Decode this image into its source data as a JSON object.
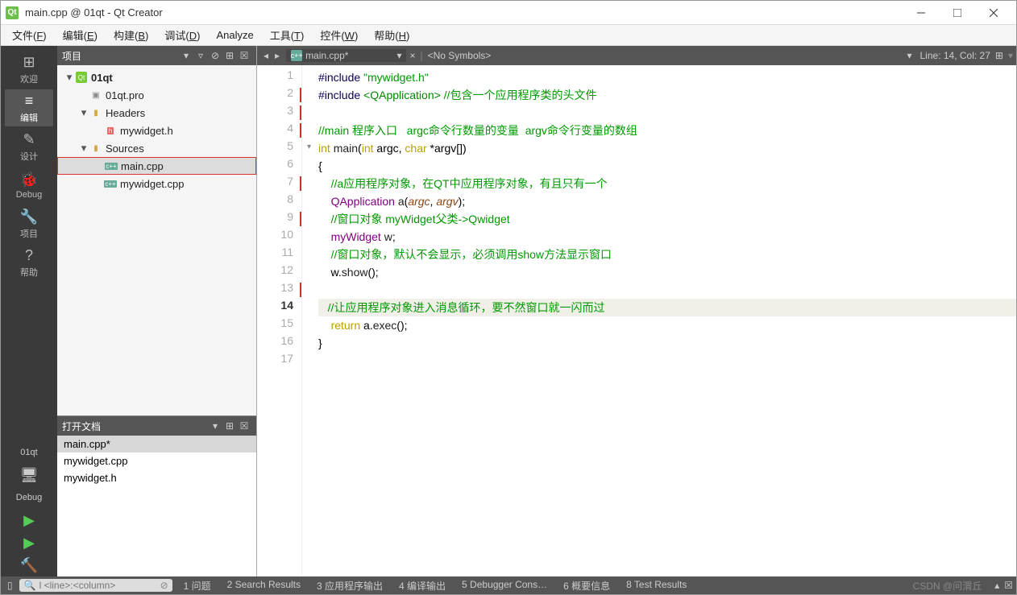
{
  "title": "main.cpp @ 01qt - Qt Creator",
  "menus": [
    "文件(F)",
    "编辑(E)",
    "构建(B)",
    "调试(D)",
    "Analyze",
    "工具(T)",
    "控件(W)",
    "帮助(H)"
  ],
  "modes": [
    {
      "icon": "⊞",
      "label": "欢迎"
    },
    {
      "icon": "≡",
      "label": "编辑",
      "active": true
    },
    {
      "icon": "✎",
      "label": "设计"
    },
    {
      "icon": "🐞",
      "label": "Debug"
    },
    {
      "icon": "🔧",
      "label": "项目"
    },
    {
      "icon": "?",
      "label": "帮助"
    }
  ],
  "run_targets": [
    {
      "label": "01qt"
    },
    {
      "label": "🖥"
    },
    {
      "label": "Debug"
    },
    {
      "label": "▶",
      "color": "#5c5"
    },
    {
      "label": "▶",
      "color": "#5c5",
      "bug": true
    },
    {
      "label": "🔨",
      "color": "#d97"
    }
  ],
  "projectPane": {
    "title": "项目",
    "tree": [
      {
        "indent": 0,
        "chev": "▾",
        "icon": "qt",
        "name": "01qt",
        "bold": true
      },
      {
        "indent": 1,
        "chev": "",
        "icon": "pro",
        "name": "01qt.pro"
      },
      {
        "indent": 1,
        "chev": "▾",
        "icon": "fld",
        "name": "Headers"
      },
      {
        "indent": 2,
        "chev": "",
        "icon": "h",
        "name": "mywidget.h"
      },
      {
        "indent": 1,
        "chev": "▾",
        "icon": "fld",
        "name": "Sources"
      },
      {
        "indent": 2,
        "chev": "",
        "icon": "cpp",
        "name": "main.cpp",
        "sel": true,
        "boxed": true
      },
      {
        "indent": 2,
        "chev": "",
        "icon": "cpp",
        "name": "mywidget.cpp"
      }
    ]
  },
  "openDocs": {
    "title": "打开文档",
    "items": [
      {
        "name": "main.cpp*",
        "sel": true
      },
      {
        "name": "mywidget.cpp"
      },
      {
        "name": "mywidget.h"
      }
    ]
  },
  "tab": {
    "file": "main.cpp*",
    "symbols": "<No Symbols>",
    "pos": "Line: 14, Col: 27"
  },
  "code": [
    {
      "n": 1,
      "html": "<span class='pp'>#include</span> <span class='str'>\"mywidget.h\"</span>"
    },
    {
      "n": 2,
      "mark": true,
      "html": "<span class='pp'>#include</span> <span class='inc'>&lt;QApplication&gt;</span> <span class='cmt'>//包含一个应用程序类的头文件</span>"
    },
    {
      "n": 3,
      "mark": true,
      "html": ""
    },
    {
      "n": 4,
      "mark": true,
      "html": "<span class='cmt'>//main 程序入口   argc命令行数量的变量  argv命令行变量的数组</span>"
    },
    {
      "n": 5,
      "fold": true,
      "html": "<span class='kw'>int</span> <span class='fn'>main</span>(<span class='kw'>int</span> argc, <span class='kw'>char</span> *argv[])"
    },
    {
      "n": 6,
      "html": "{"
    },
    {
      "n": 7,
      "mark": true,
      "html": "    <span class='cmt'>//a应用程序对象，在QT中应用程序对象，有且只有一个</span>"
    },
    {
      "n": 8,
      "html": "    <span class='ty'>QApplication</span> <span class='fn'>a</span>(<span class='var'>argc</span>, <span class='var'>argv</span>);"
    },
    {
      "n": 9,
      "mark": true,
      "html": "    <span class='cmt'>//窗口对象 myWidget父类-&gt;Qwidget</span>"
    },
    {
      "n": 10,
      "html": "    <span class='ty'>myWidget</span> <span class='fn'>w</span>;"
    },
    {
      "n": 11,
      "html": "    <span class='cmt'>//窗口对象，默认不会显示，必须调用show方法显示窗口</span>"
    },
    {
      "n": 12,
      "html": "    w.<span class='fn'>show</span>();"
    },
    {
      "n": 13,
      "mark": true,
      "html": ""
    },
    {
      "n": 14,
      "cur": true,
      "hl": true,
      "html": "   <span class='cmt'>//让应用程序对象进入消息循环，要不然窗口就一闪而过</span>"
    },
    {
      "n": 15,
      "html": "    <span class='kw'>return</span> a.<span class='fn'>exec</span>();"
    },
    {
      "n": 16,
      "html": "}"
    },
    {
      "n": 17,
      "html": ""
    }
  ],
  "locator": {
    "placeholder": "l <line>:<column>"
  },
  "outputs": [
    "1 问题",
    "2 Search Results",
    "3 应用程序输出",
    "4 编译输出",
    "5 Debugger Cons…",
    "6 概要信息",
    "8 Test Results"
  ],
  "watermark": "CSDN @问渭丘"
}
